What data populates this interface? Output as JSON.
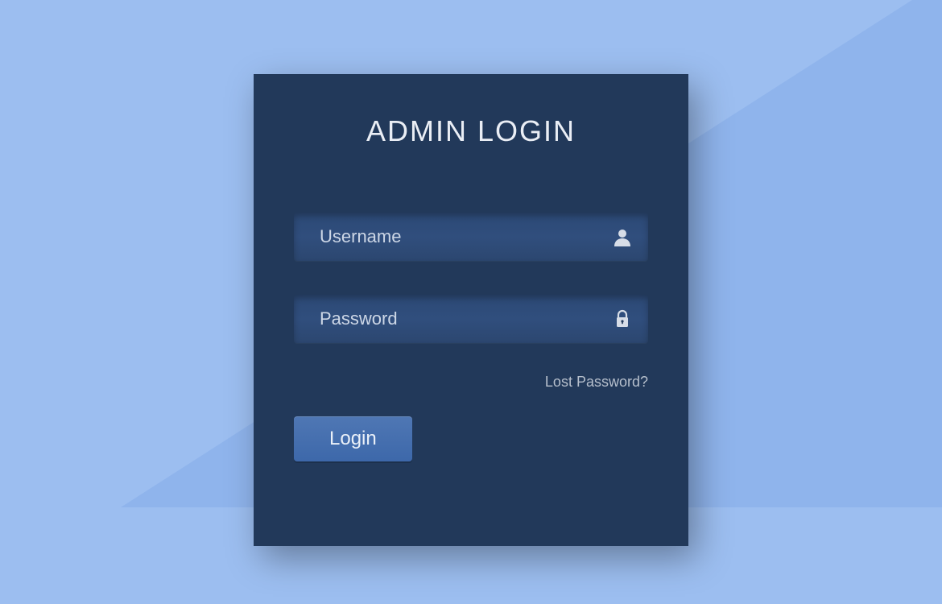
{
  "title": "ADMIN LOGIN",
  "fields": {
    "username": {
      "placeholder": "Username",
      "value": ""
    },
    "password": {
      "placeholder": "Password",
      "value": ""
    }
  },
  "links": {
    "lost_password": "Lost Password?"
  },
  "buttons": {
    "login": "Login"
  }
}
